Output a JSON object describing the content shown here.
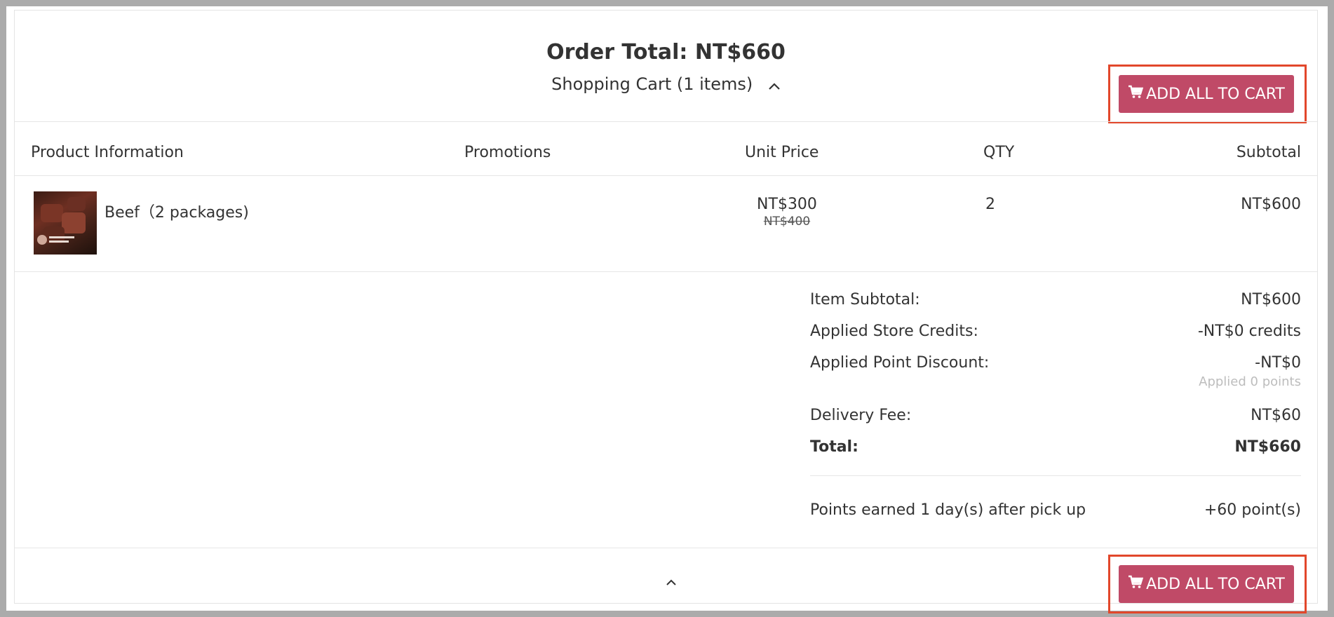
{
  "header": {
    "order_total": "Order Total: NT$660",
    "cart_toggle": "Shopping Cart (1 items)",
    "toggle_icon": "chevron-up-icon"
  },
  "buttons": {
    "add_all_label": "ADD ALL TO CART",
    "add_all_icon": "cart-icon",
    "accent_color": "#c04a67",
    "highlight_color": "#e2472b"
  },
  "table": {
    "columns": [
      "Product Information",
      "Promotions",
      "Unit Price",
      "QTY",
      "Subtotal"
    ],
    "rows": [
      {
        "product": "Beef（2 packages)",
        "promotion": "",
        "unit_price": "NT$300",
        "original_price": "NT$400",
        "qty": "2",
        "subtotal": "NT$600"
      }
    ]
  },
  "summary": {
    "item_subtotal_label": "Item Subtotal:",
    "item_subtotal_value": "NT$600",
    "store_credits_label": "Applied Store Credits:",
    "store_credits_value": "-NT$0 credits",
    "point_discount_label": "Applied Point Discount:",
    "point_discount_value": "-NT$0",
    "point_discount_sub": "Applied 0 points",
    "delivery_label": "Delivery Fee:",
    "delivery_value": "NT$60",
    "total_label": "Total:",
    "total_value": "NT$660",
    "points_label": "Points earned 1 day(s) after pick up",
    "points_value": "+60 point(s)"
  },
  "footer": {
    "collapse_icon": "chevron-up-icon"
  }
}
